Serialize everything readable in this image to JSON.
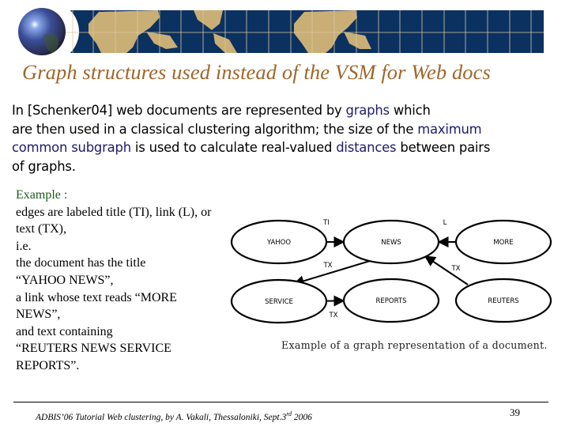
{
  "header": {
    "title": "Graph structures used  instead of the VSM  for Web docs",
    "banner_colors": {
      "ocean": "#0B3160",
      "land": "#C9AE76",
      "grid": "#D9C9A0"
    }
  },
  "body": {
    "lines": [
      [
        {
          "text": "In [Schenker04] web documents are represented by ",
          "hl": false
        },
        {
          "text": "graphs",
          "hl": true
        },
        {
          "text": " which",
          "hl": false
        }
      ],
      [
        {
          "text": "are then used in a classical clustering algorithm; the size of the ",
          "hl": false
        },
        {
          "text": "maximum",
          "hl": true
        }
      ],
      [
        {
          "text": "common subgraph",
          "hl": true
        },
        {
          "text": " is used to calculate real-valued ",
          "hl": false
        },
        {
          "text": "distances",
          "hl": true
        },
        {
          "text": " between pairs",
          "hl": false
        }
      ],
      [
        {
          "text": "of graphs.",
          "hl": false
        }
      ]
    ]
  },
  "example": {
    "heading": "Example :",
    "lines": [
      "edges are labeled title (TI), link (L), or",
      "text (TX),",
      "i.e.",
      "the document has the title",
      "“YAHOO NEWS”,",
      "a link whose text reads “MORE",
      "NEWS”,",
      "and text containing",
      "“REUTERS NEWS SERVICE",
      "REPORTS”."
    ]
  },
  "diagram": {
    "nodes": [
      {
        "id": "yahoo",
        "label": "YAHOO"
      },
      {
        "id": "news",
        "label": "NEWS"
      },
      {
        "id": "more",
        "label": "MORE"
      },
      {
        "id": "service",
        "label": "SERVICE"
      },
      {
        "id": "reports",
        "label": "REPORTS"
      },
      {
        "id": "reuters",
        "label": "REUTERS"
      }
    ],
    "edges": [
      {
        "from": "yahoo",
        "to": "news",
        "label": "TI"
      },
      {
        "from": "more",
        "to": "news",
        "label": "L"
      },
      {
        "from": "news",
        "to": "service",
        "label": "TX"
      },
      {
        "from": "reuters",
        "to": "news",
        "label": "TX"
      },
      {
        "from": "service",
        "to": "reports",
        "label": "TX"
      }
    ],
    "caption": "Example of a graph representation of a document."
  },
  "footer": {
    "text_main": "ADBIS’06 Tutorial Web clustering, by A. Vakali, Thessaloniki, Sept.3",
    "text_sup": "rd",
    "text_year": " 2006",
    "page_number": "39"
  }
}
